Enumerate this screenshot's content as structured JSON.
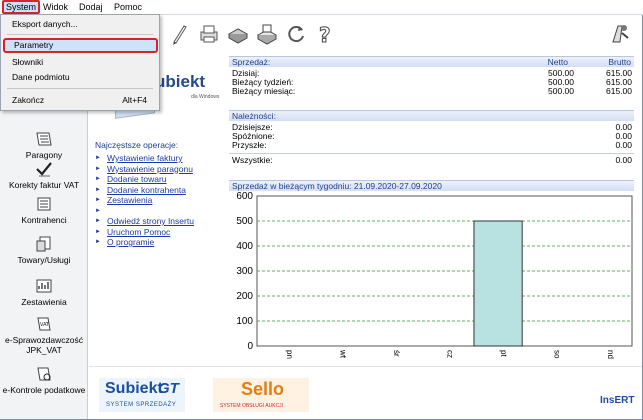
{
  "menu": {
    "items": [
      {
        "label": "System",
        "active": true
      },
      {
        "label": "Widok"
      },
      {
        "label": "Dodaj"
      },
      {
        "label": "Pomoc"
      }
    ]
  },
  "system_menu": {
    "items": [
      {
        "label": "Eksport danych..."
      },
      {
        "label": "Parametry",
        "highlighted": true
      },
      {
        "label": "Słowniki"
      },
      {
        "label": "Dane podmiotu"
      },
      {
        "label": "Zakończ",
        "shortcut": "Alt+F4"
      }
    ]
  },
  "nav": {
    "items": [
      {
        "label": "Paragony",
        "icon": "receipt-icon"
      },
      {
        "label": "Korekty faktur VAT",
        "icon": "check-correction-icon"
      },
      {
        "label": "Kontrahenci",
        "icon": "contractors-icon"
      },
      {
        "label": "Towary/Usługi",
        "icon": "products-icon"
      },
      {
        "label": "Zestawienia",
        "icon": "reports-icon"
      },
      {
        "label": "e-Sprawozdawczość",
        "label2": "JPK_VAT",
        "icon": "jpk-vat-icon"
      },
      {
        "label": "e-Kontrole podatkowe",
        "icon": "tax-control-icon"
      }
    ]
  },
  "logo": {
    "text": "ubiekt",
    "sub": "dla Windows"
  },
  "operations": {
    "title": "Najczęstsze operacje:",
    "group1": [
      "Wystawienie faktury",
      "Wystawienie paragonu",
      "Dodanie towaru",
      "Dodanie kontrahenta",
      "Zestawienia"
    ],
    "group2": [
      "Odwiedź strony Insertu",
      "Uruchom Pomoc",
      "O programie"
    ]
  },
  "sales": {
    "title": "Sprzedaż:",
    "col_net": "Netto",
    "col_gross": "Brutto",
    "rows": [
      {
        "label": "Dzisiaj:",
        "net": "500.00",
        "gross": "615.00"
      },
      {
        "label": "Bieżący tydzień:",
        "net": "500.00",
        "gross": "615.00"
      },
      {
        "label": "Bieżący miesiąc:",
        "net": "500.00",
        "gross": "615.00"
      }
    ]
  },
  "receivables": {
    "title": "Należności:",
    "rows": [
      {
        "label": "Dzisiejsze:",
        "value": "0.00"
      },
      {
        "label": "Spóźnione:",
        "value": "0.00"
      },
      {
        "label": "Przyszłe:",
        "value": "0.00"
      }
    ],
    "total": {
      "label": "Wszystkie:",
      "value": "0.00"
    }
  },
  "chart_data": {
    "type": "bar",
    "title": "Sprzedaż w bieżącym tygodniu: 21.09.2020-27.09.2020",
    "categories": [
      "pn",
      "wt",
      "śr",
      "cz",
      "pt",
      "so",
      "nd"
    ],
    "values": [
      0,
      0,
      0,
      0,
      500,
      0,
      0
    ],
    "ylim": [
      0,
      600
    ],
    "yticks": [
      0,
      100,
      200,
      300,
      400,
      500,
      600
    ],
    "grid": true,
    "bar_color": "#b8e2e2"
  },
  "footer": {
    "subiekt_gt": "Subiekt",
    "subiekt_gt_mark": "GT",
    "subiekt_gt_sub": "SYSTEM SPRZEDAŻY",
    "sello": "Sello",
    "sello_sub": "SYSTEM OBSŁUGI AUKCJI",
    "insert": "InsERT"
  },
  "colors": {
    "accent": "#1d3f8a",
    "highlight_border": "#d0272b",
    "link": "#1d3aa8"
  }
}
